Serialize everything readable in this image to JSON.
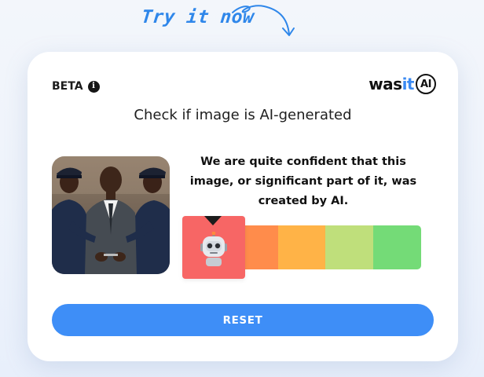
{
  "hint": {
    "text": "Try it now",
    "color": "#2f87ea"
  },
  "card": {
    "beta_label": "BETA",
    "info_icon": "info-icon",
    "logo": {
      "prefix": "was",
      "accent": "it",
      "badge": "AI",
      "accent_color": "#3b8af2"
    },
    "headline": "Check if image is AI-generated",
    "image": {
      "description_icon": "uploaded-image"
    },
    "verdict": "We are quite confident that this image, or significant part of it, was created by AI.",
    "meter": {
      "segments": [
        "#f76665",
        "#ff8c4b",
        "#ffb347",
        "#bfdf7b",
        "#74db77"
      ],
      "selected_index": 0,
      "selected_icon": "robot-icon"
    },
    "reset_label": "RESET",
    "button_color": "#3e8ef7"
  }
}
